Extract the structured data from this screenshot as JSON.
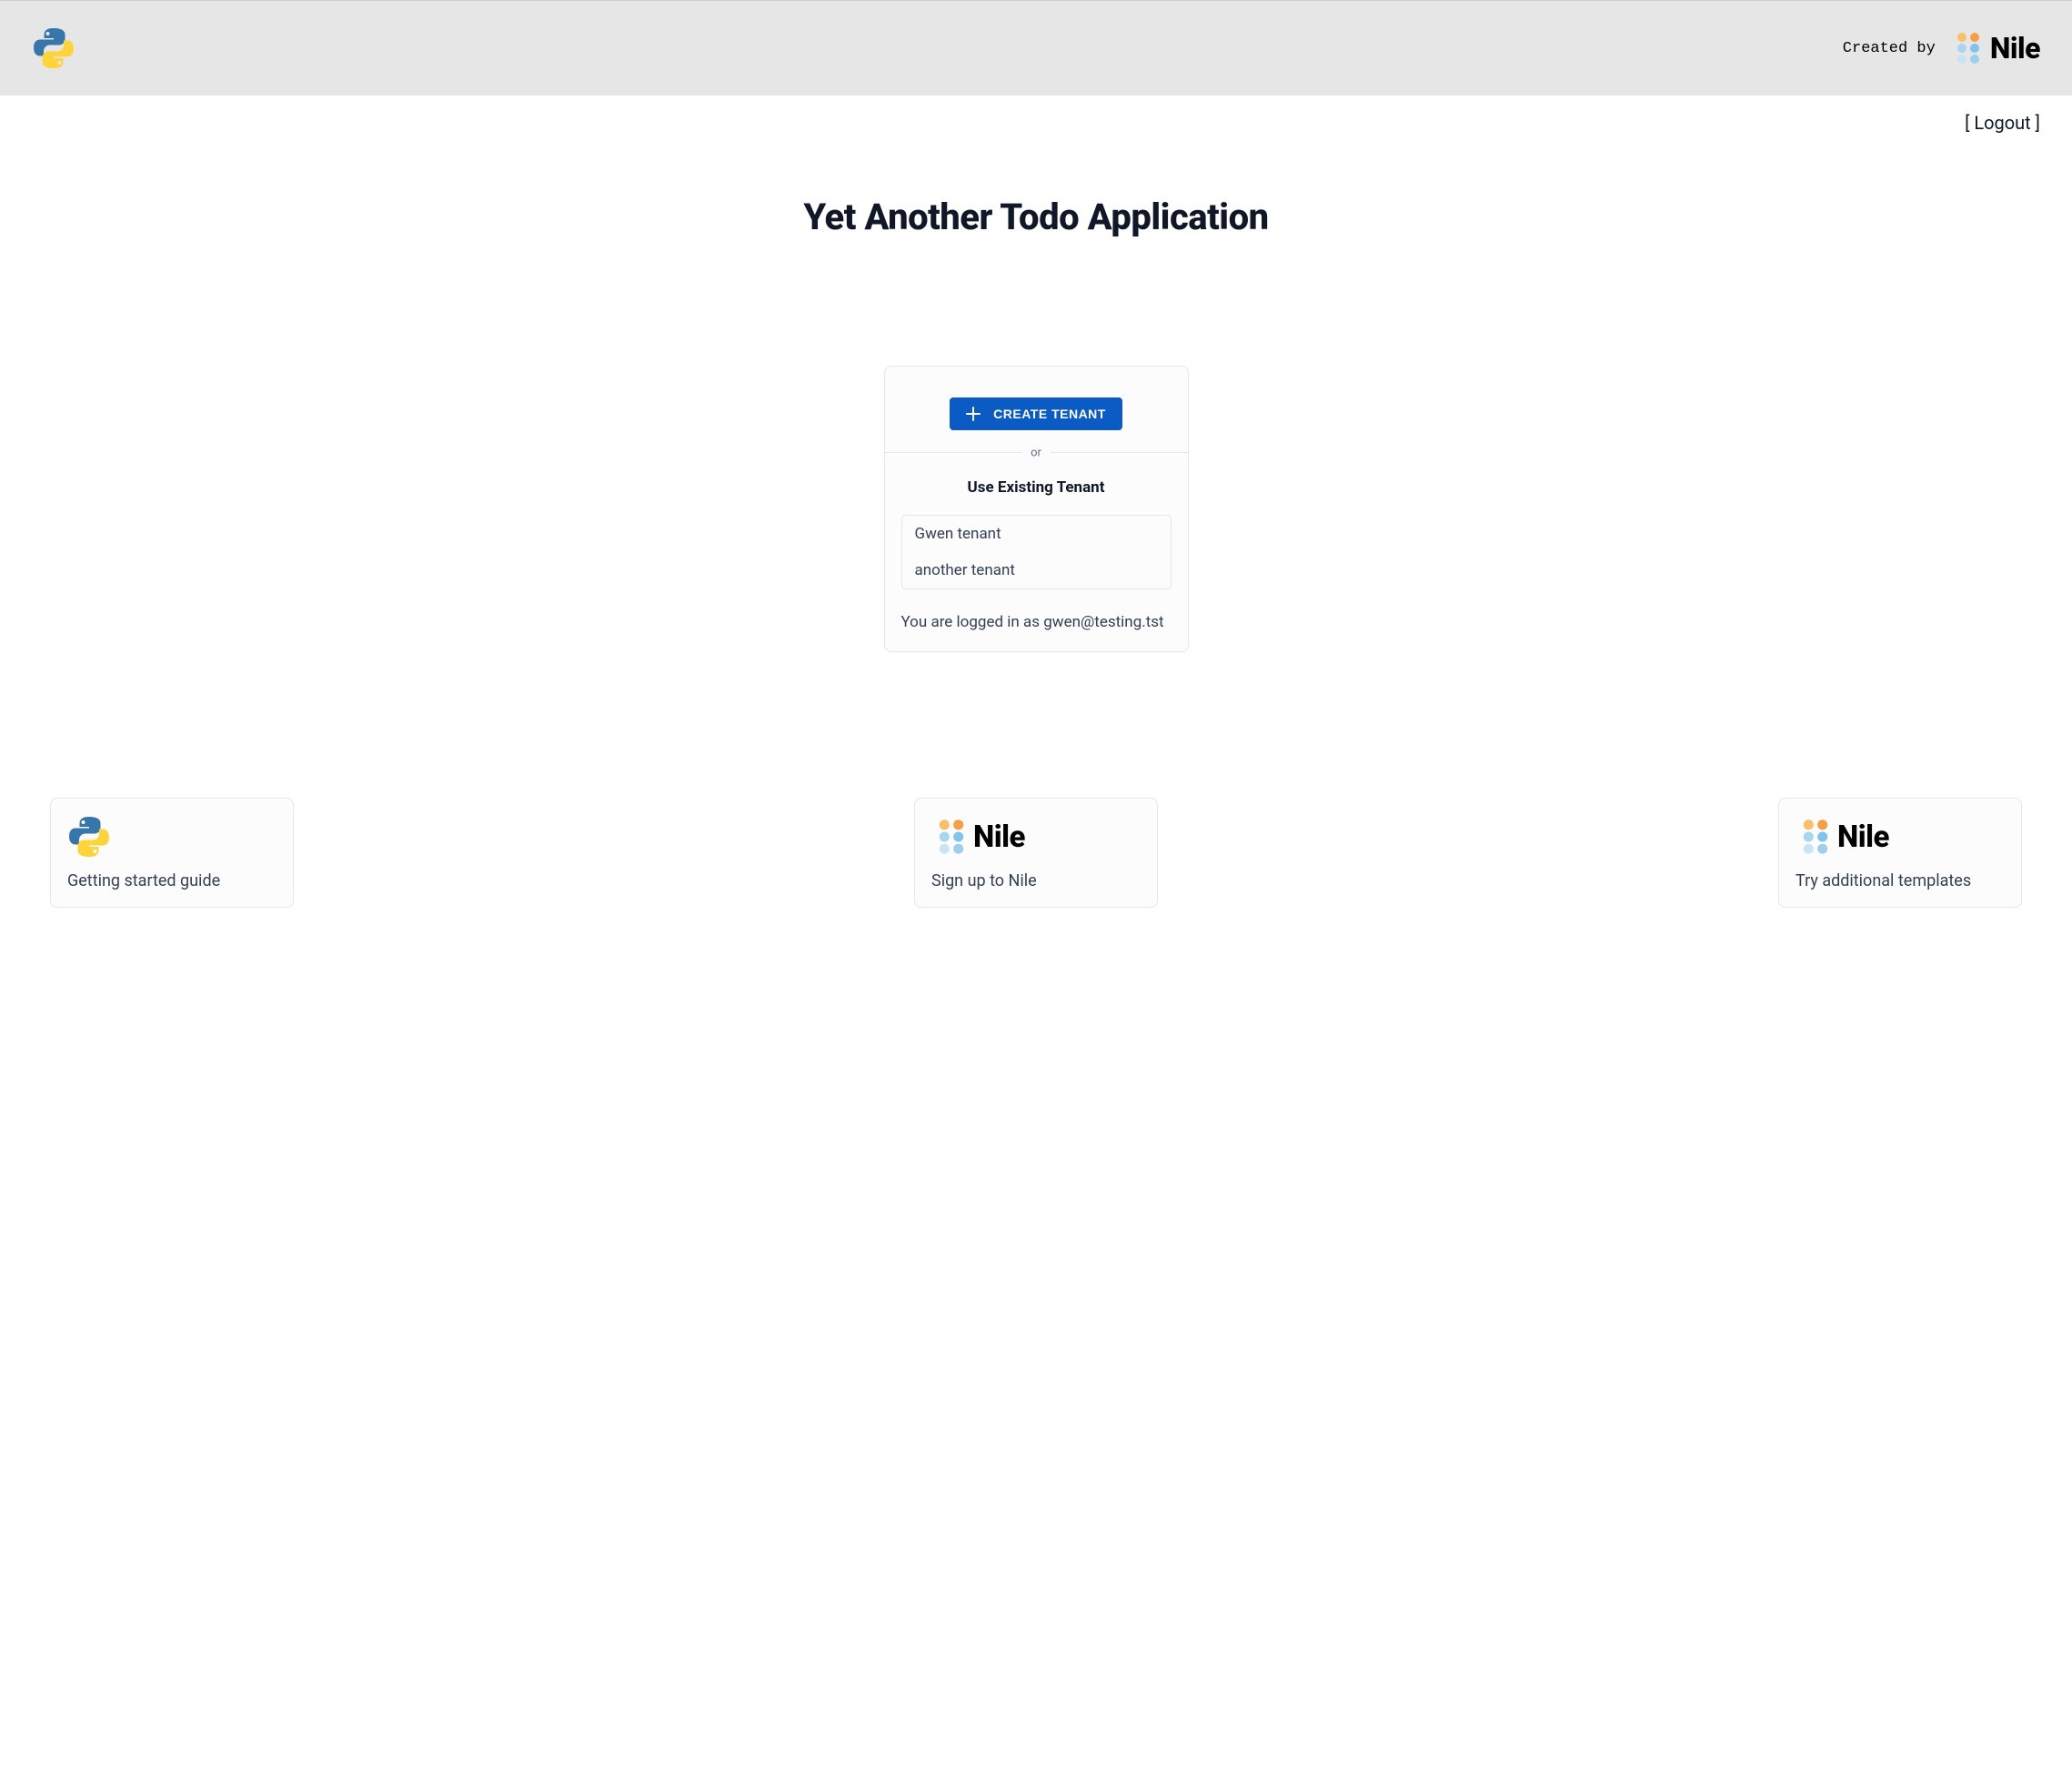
{
  "header": {
    "created_by_label": "Created by",
    "brand_name": "Nile"
  },
  "logout": {
    "label": "[ Logout ]"
  },
  "page": {
    "title": "Yet Another Todo Application"
  },
  "tenant_card": {
    "create_button_label": "CREATE TENANT",
    "divider_text": "or",
    "existing_title": "Use Existing Tenant",
    "tenants": [
      "Gwen tenant",
      "another tenant"
    ],
    "logged_in_prefix": "You are logged in as ",
    "logged_in_email": "gwen@testing.tst"
  },
  "info_cards": [
    {
      "icon": "python",
      "label": "Getting started guide"
    },
    {
      "icon": "nile",
      "label": "Sign up to Nile"
    },
    {
      "icon": "nile",
      "label": "Try additional templates"
    }
  ]
}
